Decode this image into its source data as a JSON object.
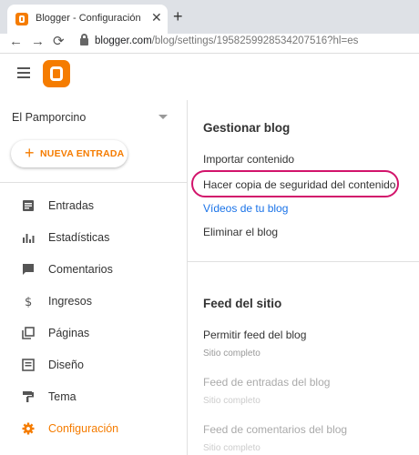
{
  "browser": {
    "tab_title": "Blogger - Configuración",
    "tab_close": "✕",
    "new_tab": "+",
    "back": "←",
    "forward": "→",
    "reload": "⟳",
    "url_host": "blogger.com",
    "url_path": "/blog/settings/1958259928534207516?hl=es"
  },
  "header": {
    "menu_icon": "hamburger-icon",
    "logo_icon": "blogger-logo"
  },
  "sidebar": {
    "blog_name": "El Pamporcino",
    "new_post": "NUEVA ENTRADA",
    "new_post_plus": "+",
    "items": [
      {
        "label": "Entradas",
        "icon": "posts-icon"
      },
      {
        "label": "Estadísticas",
        "icon": "stats-icon"
      },
      {
        "label": "Comentarios",
        "icon": "comment-icon"
      },
      {
        "label": "Ingresos",
        "icon": "dollar-icon"
      },
      {
        "label": "Páginas",
        "icon": "pages-icon"
      },
      {
        "label": "Diseño",
        "icon": "layout-icon"
      },
      {
        "label": "Tema",
        "icon": "theme-icon"
      },
      {
        "label": "Configuración",
        "icon": "gear-icon"
      }
    ],
    "accent_color": "#f57c00"
  },
  "main": {
    "manage": {
      "title": "Gestionar blog",
      "import": "Importar contenido",
      "backup": "Hacer copia de seguridad del contenido",
      "videos": "Vídeos de tu blog",
      "delete": "Eliminar el blog"
    },
    "feed": {
      "title": "Feed del sitio",
      "allow_label": "Permitir feed del blog",
      "allow_value": "Sitio completo",
      "posts_label": "Feed de entradas del blog",
      "posts_value": "Sitio completo",
      "comments_label": "Feed de comentarios del blog",
      "comments_value": "Sitio completo"
    },
    "highlight_color": "#d2146b"
  }
}
